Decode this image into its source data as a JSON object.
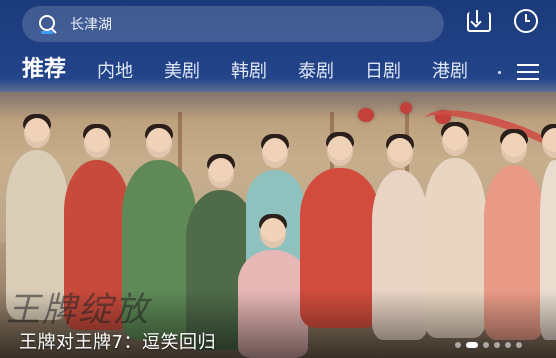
{
  "search": {
    "placeholder": "长津湖",
    "icon": "search-icon"
  },
  "toolbar": {
    "download_icon": "download-icon",
    "history_icon": "history-icon"
  },
  "tabs": [
    {
      "label": "推荐",
      "active": true
    },
    {
      "label": "内地",
      "active": false
    },
    {
      "label": "美剧",
      "active": false
    },
    {
      "label": "韩剧",
      "active": false
    },
    {
      "label": "泰剧",
      "active": false
    },
    {
      "label": "日剧",
      "active": false
    },
    {
      "label": "港剧",
      "active": false
    }
  ],
  "tab_menu_icon": "menu-icon",
  "banner": {
    "title": "王牌对王牌7：逗笑回归",
    "current_slide": 2,
    "slide_count": 6
  },
  "colors": {
    "header_bg": "#1d3a78",
    "active_tab_indicator": "#3aa0ff",
    "text": "#ffffff"
  }
}
